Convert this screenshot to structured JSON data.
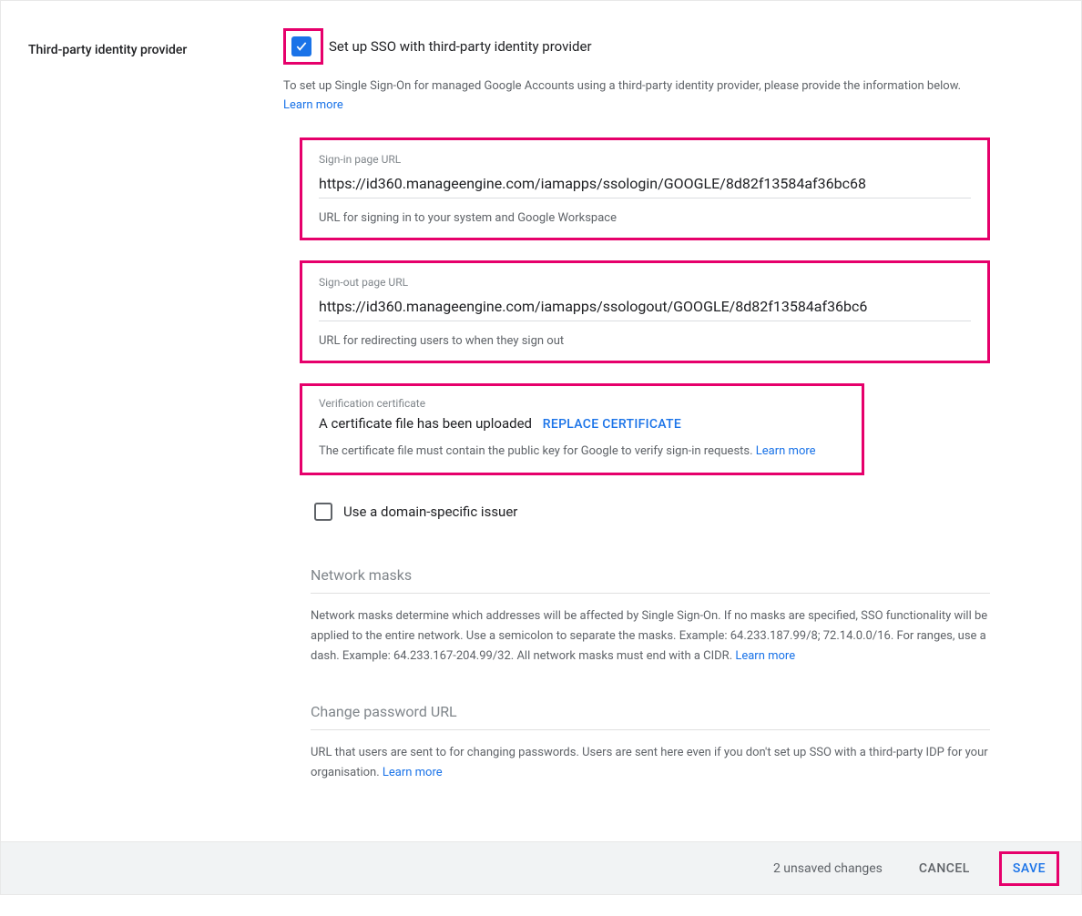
{
  "section_label": "Third-party identity provider",
  "sso_checkbox": {
    "label": "Set up SSO with third-party identity provider",
    "checked": true
  },
  "intro_text": "To set up Single Sign-On for managed Google Accounts using a third-party identity provider, please provide the information below. ",
  "learn_more": "Learn more",
  "signin": {
    "label": "Sign-in page URL",
    "value": "https://id360.manageengine.com/iamapps/ssologin/GOOGLE/8d82f13584af36bc68",
    "hint": "URL for signing in to your system and Google Workspace"
  },
  "signout": {
    "label": "Sign-out page URL",
    "value": "https://id360.manageengine.com/iamapps/ssologout/GOOGLE/8d82f13584af36bc6",
    "hint": "URL for redirecting users to when they sign out"
  },
  "cert": {
    "label": "Verification certificate",
    "status": "A certificate file has been uploaded",
    "action": "REPLACE CERTIFICATE",
    "hint": "The certificate file must contain the public key for Google to verify sign-in requests. "
  },
  "domain_issuer": {
    "label": "Use a domain-specific issuer",
    "checked": false
  },
  "network_masks": {
    "title": "Network masks",
    "desc": "Network masks determine which addresses will be affected by Single Sign-On. If no masks are specified, SSO functionality will be applied to the entire network. Use a semicolon to separate the masks. Example: 64.233.187.99/8; 72.14.0.0/16. For ranges, use a dash. Example: 64.233.167-204.99/32. All network masks must end with a CIDR. "
  },
  "change_password": {
    "title": "Change password URL",
    "desc": "URL that users are sent to for changing passwords. Users are sent here even if you don't set up SSO with a third-party IDP for your organisation. "
  },
  "footer": {
    "unsaved": "2 unsaved changes",
    "cancel": "CANCEL",
    "save": "SAVE"
  }
}
